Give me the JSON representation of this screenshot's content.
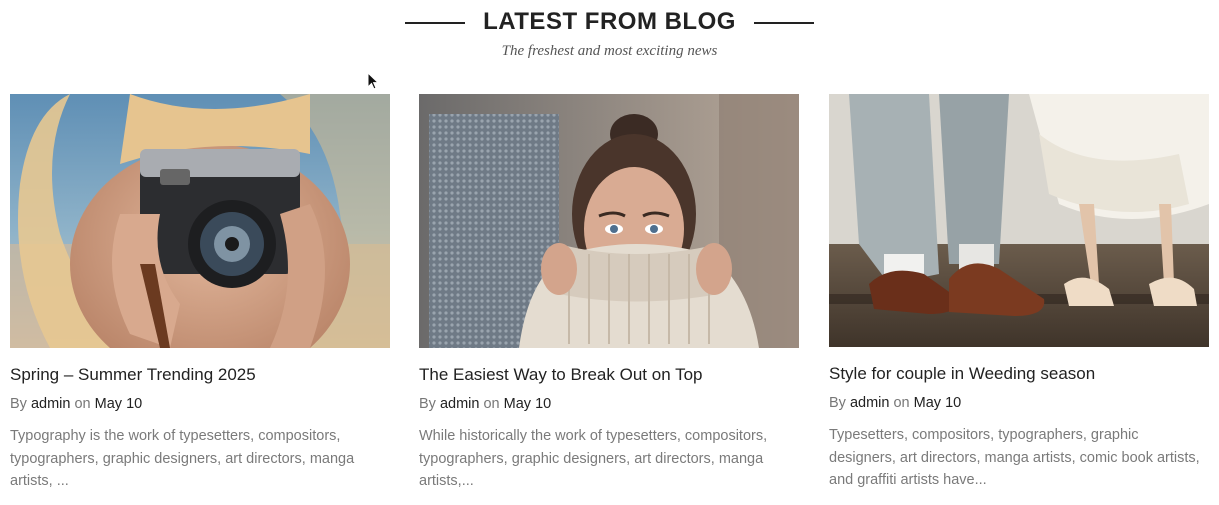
{
  "section": {
    "title": "LATEST FROM BLOG",
    "subtitle": "The freshest and most exciting news"
  },
  "posts": [
    {
      "title": "Spring – Summer Trending 2025",
      "by_label": "By",
      "author": "admin",
      "on_label": "on",
      "date": "May 10",
      "excerpt": "Typography is the work of typesetters, compositors, typographers, graphic designers, art directors, manga artists, ...",
      "image": "woman-with-camera-photo"
    },
    {
      "title": "The Easiest Way to Break Out on Top",
      "by_label": "By",
      "author": "admin",
      "on_label": "on",
      "date": "May 10",
      "excerpt": "While historically the work of typesetters, compositors, typographers, graphic designers, art directors, manga artists,...",
      "image": "woman-in-sweater-photo"
    },
    {
      "title": "Style for couple in Weeding season",
      "by_label": "By",
      "author": "admin",
      "on_label": "on",
      "date": "May 10",
      "excerpt": "Typesetters, compositors, typographers, graphic designers, art directors, manga artists, comic book artists, and graffiti artists have...",
      "image": "couple-shoes-photo"
    }
  ]
}
